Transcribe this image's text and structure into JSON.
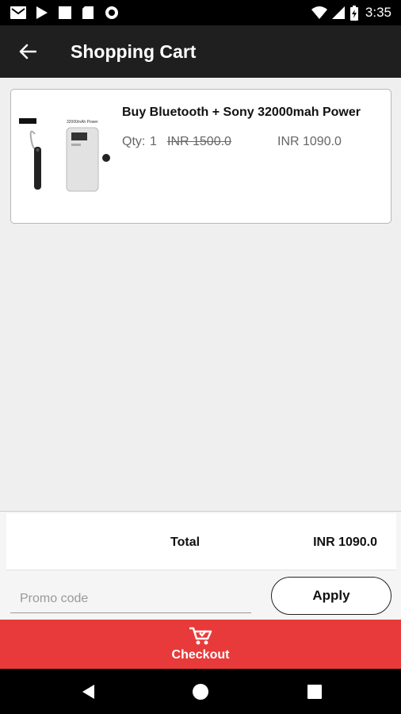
{
  "status_bar": {
    "time": "3:35",
    "left_icons": [
      "gmail-icon",
      "play-store-icon",
      "square-notification-icon",
      "sd-card-icon",
      "circle-notification-icon"
    ],
    "right_icons": [
      "wifi-icon",
      "cellular-signal-icon",
      "battery-icon"
    ]
  },
  "app_bar": {
    "title": "Shopping Cart",
    "back_icon": "arrow-left-icon"
  },
  "cart": {
    "items": [
      {
        "name": "Buy Bluetooth + Sony 32000mah Power",
        "qty_label": "Qty:",
        "qty": "1",
        "original_price": "INR 1500.0",
        "price": "INR 1090.0",
        "image_text": "32000mAh Power"
      }
    ]
  },
  "summary": {
    "total_label": "Total",
    "total_value": "INR 1090.0"
  },
  "promo": {
    "placeholder": "Promo code",
    "value": "",
    "apply_label": "Apply"
  },
  "checkout": {
    "label": "Checkout",
    "icon": "cart-icon"
  },
  "colors": {
    "app_bar": "#1f1f1f",
    "checkout": "#e83a3a",
    "background": "#efefef"
  }
}
